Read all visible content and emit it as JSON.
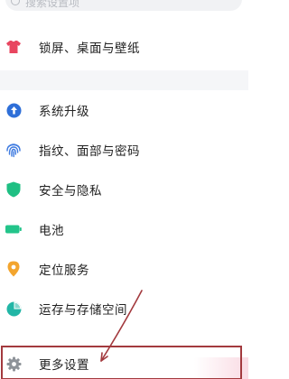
{
  "search": {
    "placeholder": "搜索设置项"
  },
  "settings": {
    "items": [
      {
        "label": "锁屏、桌面与壁纸",
        "icon": "shirt-icon",
        "color": "#e8455f"
      },
      {
        "label": "系统升级",
        "icon": "arrow-up-circle-icon",
        "color": "#2e6fd8"
      },
      {
        "label": "指纹、面部与密码",
        "icon": "fingerprint-icon",
        "color": "#3f7be0"
      },
      {
        "label": "安全与隐私",
        "icon": "shield-icon",
        "color": "#1fbf83"
      },
      {
        "label": "电池",
        "icon": "battery-icon",
        "color": "#23c48a"
      },
      {
        "label": "定位服务",
        "icon": "location-pin-icon",
        "color": "#f3a52e"
      },
      {
        "label": "运存与存储空间",
        "icon": "pie-chart-icon",
        "color": "#22b6a6"
      },
      {
        "label": "更多设置",
        "icon": "gear-icon",
        "color": "#8e9399"
      }
    ]
  },
  "annotation": {
    "highlight_color": "#a33a3e"
  }
}
